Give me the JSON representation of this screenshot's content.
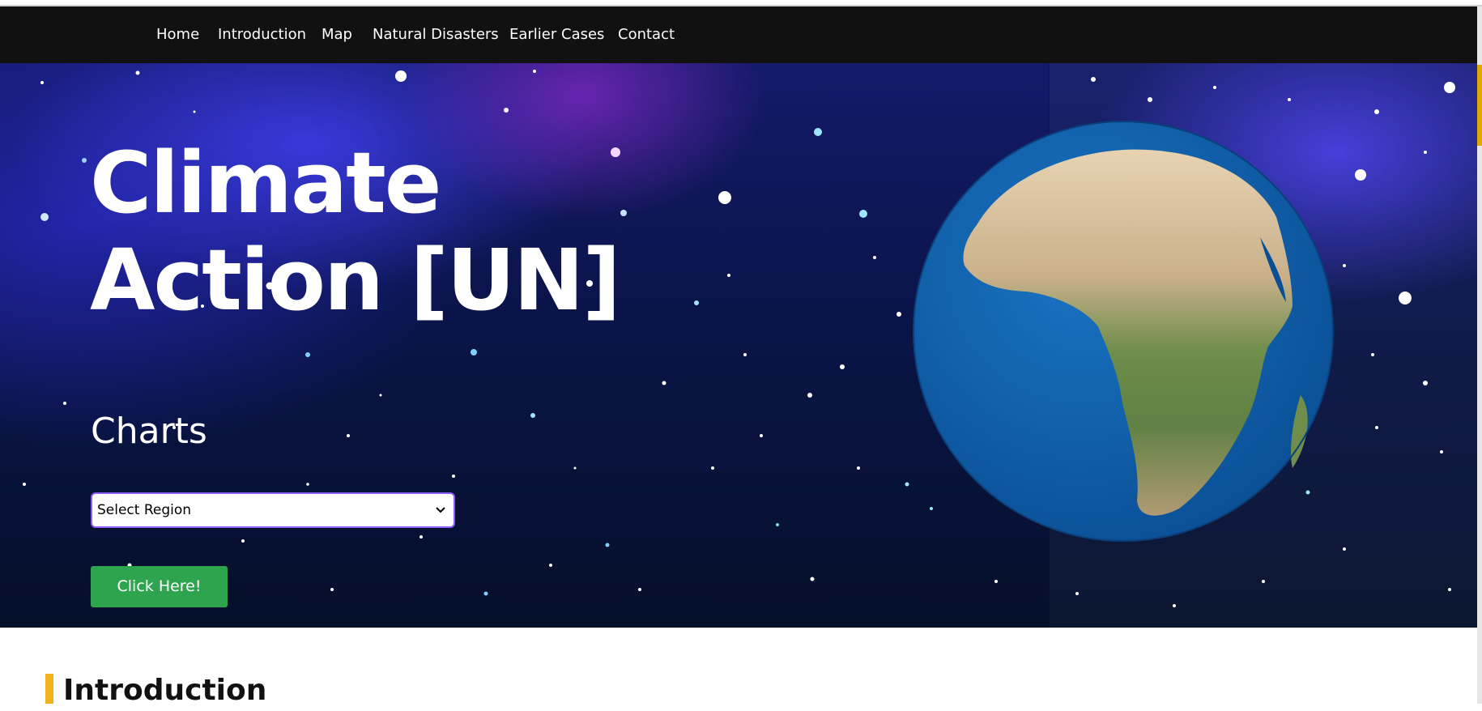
{
  "nav": {
    "items": [
      {
        "label": "Home"
      },
      {
        "label": "Introduction"
      },
      {
        "label": "Map"
      },
      {
        "label": "Natural Disasters"
      },
      {
        "label": "Earlier Cases"
      },
      {
        "label": "Contact"
      }
    ]
  },
  "hero": {
    "title_line1": "Climate",
    "title_line2": "Action [UN]",
    "subtitle": "Charts",
    "region_select": {
      "selected": "Select Region"
    },
    "cta_label": "Click Here!"
  },
  "intro": {
    "heading": "Introduction"
  },
  "colors": {
    "nav_bg": "#111111",
    "cta": "#2ea44f",
    "select_border": "#8b5cf6",
    "accent": "#f2b21c"
  }
}
